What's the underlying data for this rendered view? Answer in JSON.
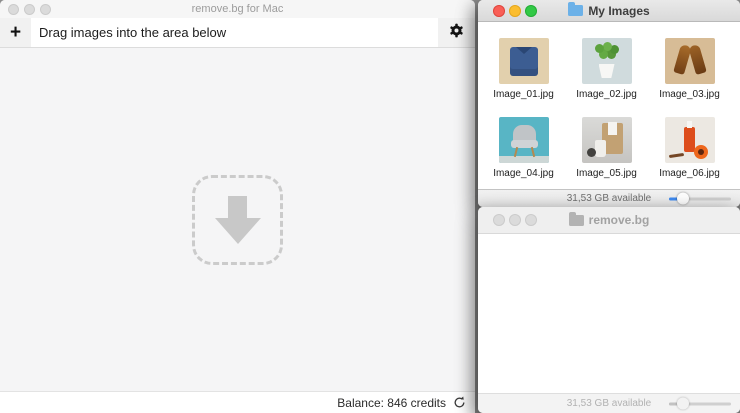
{
  "removebg_app": {
    "window_title": "remove.bg for Mac",
    "toolbar": {
      "add_label": "+",
      "hint": "Drag images into the area below",
      "gear_icon": "settings-gear"
    },
    "dropzone": {
      "icon": "download-arrow"
    },
    "statusbar": {
      "balance": "Balance: 846 credits",
      "refresh_icon": "refresh-circular-arrow"
    }
  },
  "finder_my_images": {
    "window_title": "My Images",
    "folder_icon": "blue-folder",
    "items": [
      {
        "label": "Image_01.jpg",
        "subject": "folded blue denim shirt on wooden background"
      },
      {
        "label": "Image_02.jpg",
        "subject": "green plant in white pot"
      },
      {
        "label": "Image_03.jpg",
        "subject": "pair of brown leather shoes"
      },
      {
        "label": "Image_04.jpg",
        "subject": "grey armchair on teal background"
      },
      {
        "label": "Image_05.jpg",
        "subject": "kraft paper bag with white cup"
      },
      {
        "label": "Image_06.jpg",
        "subject": "orange cosmetic bottle with flower"
      }
    ],
    "statusbar": {
      "available": "31,53 GB available"
    }
  },
  "finder_removebg": {
    "window_title": "remove.bg",
    "folder_icon": "gray-folder",
    "statusbar": {
      "available": "31,53 GB available"
    }
  },
  "colors": {
    "accent_blue": "#3f8bf0",
    "traffic_red": "#f95f57",
    "traffic_yellow": "#fbbd2e",
    "traffic_green": "#32c946",
    "drop_area_bg": "#f5f5f6",
    "dashed_border": "#cbcbcb"
  }
}
